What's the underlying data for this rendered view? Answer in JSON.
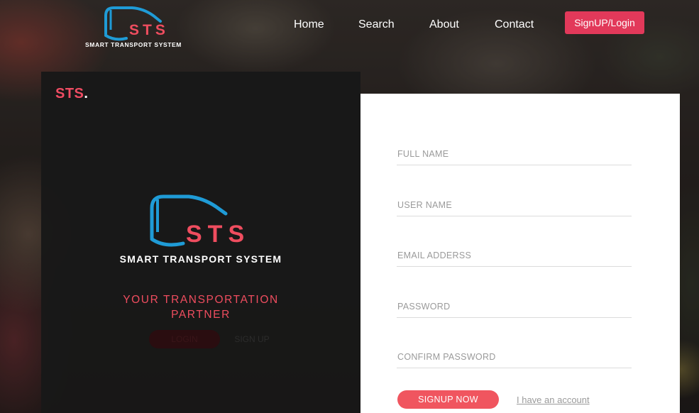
{
  "nav": {
    "logo_text": "STS",
    "logo_subtitle": "SMART TRANSPORT SYSTEM",
    "links": [
      {
        "label": "Home"
      },
      {
        "label": "Search"
      },
      {
        "label": "About"
      },
      {
        "label": "Contact"
      }
    ],
    "cta_label": "SignUP/Login"
  },
  "left_panel": {
    "brand": "STS",
    "brand_dot": ".",
    "logo_text": "STS",
    "logo_subtitle": "SMART TRANSPORT SYSTEM",
    "tagline": "YOUR TRANSPORTATION PARTNER",
    "login_label": "LOGIN",
    "signup_label": "SIGN UP"
  },
  "form": {
    "fields": [
      {
        "placeholder": "FULL NAME",
        "value": ""
      },
      {
        "placeholder": "USER NAME",
        "value": ""
      },
      {
        "placeholder": "EMAIL ADDERSS",
        "value": ""
      },
      {
        "placeholder": "PASSWORD",
        "value": ""
      },
      {
        "placeholder": "CONFIRM PASSWORD",
        "value": ""
      }
    ],
    "submit_label": "SIGNUP NOW",
    "account_link": "I have an account"
  },
  "colors": {
    "accent": "#e2395a",
    "logo_blue": "#1f9bd6",
    "logo_red": "#ef4d5f",
    "panel_dark": "#181818",
    "panel_light": "#ffffff"
  },
  "icons": [
    "bus-logo-icon"
  ]
}
